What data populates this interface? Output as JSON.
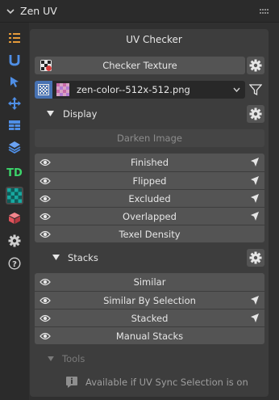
{
  "header": {
    "title": "Zen UV"
  },
  "sidebar": {
    "tabs": [
      {
        "name": "list-icon",
        "active": false
      },
      {
        "name": "zen-u-icon",
        "active": false
      },
      {
        "name": "select-arrow-icon",
        "active": false
      },
      {
        "name": "transform-icon",
        "active": false
      },
      {
        "name": "stack-panel-icon",
        "active": false
      },
      {
        "name": "layers-icon",
        "active": false
      },
      {
        "name": "td-icon",
        "label": "TD",
        "active": false
      },
      {
        "name": "checker-icon",
        "active": true
      },
      {
        "name": "cube-icon",
        "active": false
      },
      {
        "name": "gear-icon",
        "active": false
      },
      {
        "name": "help-icon",
        "label": "?",
        "active": false
      }
    ]
  },
  "main": {
    "section_title": "UV Checker",
    "checker_texture_label": "Checker Texture",
    "image_name": "zen-color--512x-512.png",
    "display": {
      "label": "Display",
      "darken_label": "Darken Image",
      "items": [
        {
          "label": "Finished",
          "has_select": true
        },
        {
          "label": "Flipped",
          "has_select": true
        },
        {
          "label": "Excluded",
          "has_select": true
        },
        {
          "label": "Overlapped",
          "has_select": true
        },
        {
          "label": "Texel Density",
          "has_select": false
        }
      ]
    },
    "stacks": {
      "label": "Stacks",
      "items": [
        {
          "label": "Similar",
          "has_select": false
        },
        {
          "label": "Similar By Selection",
          "has_select": true
        },
        {
          "label": "Stacked",
          "has_select": true
        },
        {
          "label": "Manual Stacks",
          "has_select": false
        }
      ]
    },
    "tools": {
      "label": "Tools",
      "info": "Available if UV Sync Selection is on"
    }
  },
  "colors": {
    "accent_blue": "#4772b3",
    "td_green": "#3cd46b",
    "checker_teal": "#17a8a0",
    "cube_red": "#e0535b"
  }
}
